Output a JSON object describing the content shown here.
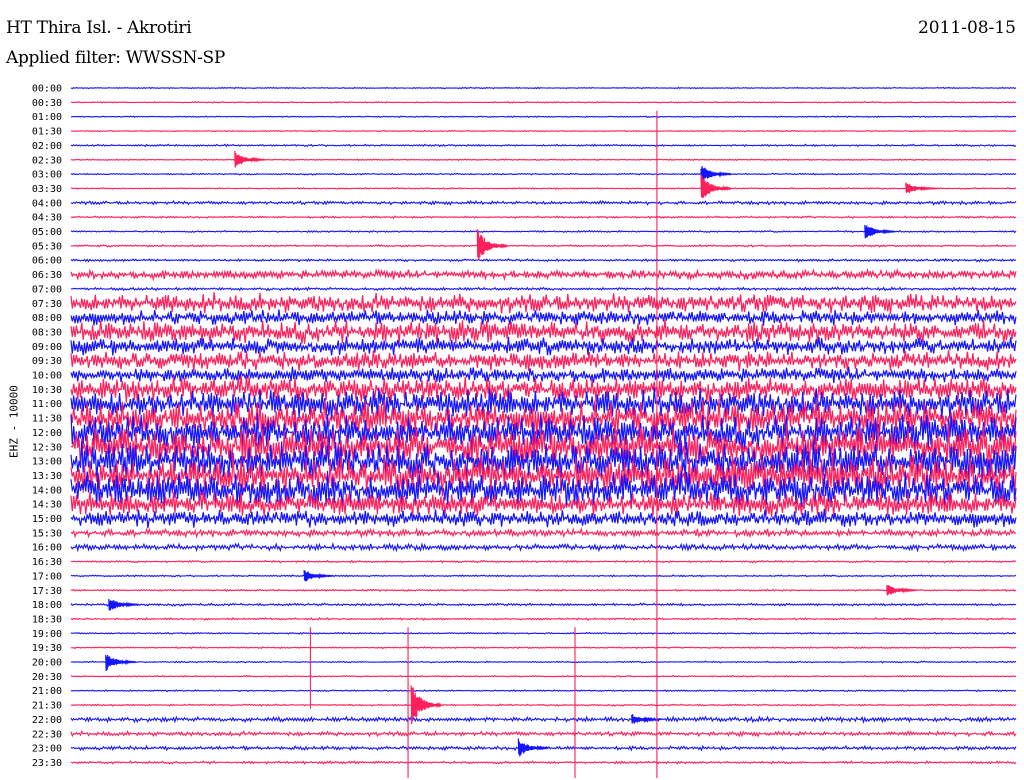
{
  "header": {
    "station": "HT Thira Isl. - Akrotiri",
    "date": "2011-08-15",
    "filter": "Applied filter: WWSSN-SP"
  },
  "chart_data": {
    "type": "line",
    "title": "HT Thira Isl. - Akrotiri",
    "ylabel": "EHZ - 10000",
    "trace_labels": [
      "00:00",
      "00:30",
      "01:00",
      "01:30",
      "02:00",
      "02:30",
      "03:00",
      "03:30",
      "04:00",
      "04:30",
      "05:00",
      "05:30",
      "06:00",
      "06:30",
      "07:00",
      "07:30",
      "08:00",
      "08:30",
      "09:00",
      "09:30",
      "10:00",
      "10:30",
      "11:00",
      "11:30",
      "12:00",
      "12:30",
      "13:00",
      "13:30",
      "14:00",
      "14:30",
      "15:00",
      "15:30",
      "16:00",
      "16:30",
      "17:00",
      "17:30",
      "18:00",
      "18:30",
      "19:00",
      "19:30",
      "20:00",
      "20:30",
      "21:00",
      "21:30",
      "22:00",
      "22:30",
      "23:00",
      "23:30"
    ],
    "series_colors": [
      "#1414ff",
      "#ff1f5a"
    ],
    "noise_level": [
      0.5,
      0.5,
      0.5,
      0.5,
      0.8,
      0.5,
      0.6,
      0.6,
      1.4,
      0.8,
      0.7,
      0.8,
      1.0,
      3.5,
      1.2,
      8,
      6,
      9,
      7,
      8,
      6,
      10,
      12,
      14,
      14,
      16,
      16,
      16,
      14,
      10,
      7,
      3,
      2.5,
      0.8,
      0.7,
      0.7,
      1.0,
      0.8,
      0.6,
      0.6,
      0.6,
      0.6,
      0.6,
      0.7,
      2.0,
      1.8,
      1.5,
      1.0
    ],
    "events": [
      {
        "trace": "02:30",
        "minute": 5.2,
        "amplitude": 9
      },
      {
        "trace": "03:00",
        "minute": 20.0,
        "amplitude": 10
      },
      {
        "trace": "03:30",
        "minute": 20.0,
        "amplitude": 16
      },
      {
        "trace": "03:30",
        "minute": 26.5,
        "amplitude": 7
      },
      {
        "trace": "05:30",
        "minute": 12.9,
        "amplitude": 18
      },
      {
        "trace": "05:00",
        "minute": 25.2,
        "amplitude": 9
      },
      {
        "trace": "17:00",
        "minute": 7.4,
        "amplitude": 7
      },
      {
        "trace": "17:30",
        "minute": 25.9,
        "amplitude": 7
      },
      {
        "trace": "18:00",
        "minute": 1.2,
        "amplitude": 8
      },
      {
        "trace": "20:00",
        "minute": 1.1,
        "amplitude": 10
      },
      {
        "trace": "21:30",
        "minute": 10.8,
        "amplitude": 22
      },
      {
        "trace": "22:00",
        "minute": 17.8,
        "amplitude": 6
      },
      {
        "trace": "23:00",
        "minute": 14.2,
        "amplitude": 10
      }
    ],
    "spikes": [
      {
        "minute": 18.6,
        "from_trace": "01:00",
        "to_trace": "23:30"
      },
      {
        "minute": 7.6,
        "from_trace": "19:00",
        "to_trace": "21:00"
      },
      {
        "minute": 10.7,
        "from_trace": "19:00",
        "to_trace": "23:30"
      },
      {
        "minute": 16.0,
        "from_trace": "19:00",
        "to_trace": "23:30"
      }
    ],
    "xlim_minutes": [
      0,
      30
    ],
    "grid": false
  }
}
